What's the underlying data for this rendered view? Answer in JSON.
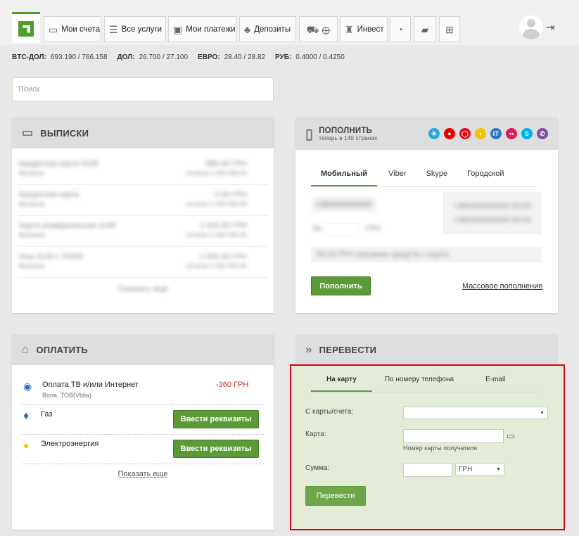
{
  "nav": {
    "items": [
      {
        "label": "Мои счета",
        "icon": "card-icon"
      },
      {
        "label": "Все услуги",
        "icon": "list-icon"
      },
      {
        "label": "Мои платежи",
        "icon": "monitor-icon"
      },
      {
        "label": "Депозиты",
        "icon": "piggy-icon"
      },
      {
        "label": "",
        "icon": "travel-icon"
      },
      {
        "label": "Инвест",
        "icon": "money-bag-icon"
      },
      {
        "label": "",
        "icon": "gauge-icon"
      },
      {
        "label": "",
        "icon": "chat-icon"
      },
      {
        "label": "",
        "icon": "cart-icon"
      }
    ]
  },
  "rates": [
    {
      "name": "BTC-ДОЛ:",
      "value": "693.190 / 766.158"
    },
    {
      "name": "ДОЛ:",
      "value": "26.700 / 27.100"
    },
    {
      "name": "ЕВРО:",
      "value": "28.40 / 28.82"
    },
    {
      "name": "РУБ:",
      "value": "0.4000 / 0.4250"
    }
  ],
  "search": {
    "placeholder": "Поиск"
  },
  "statements": {
    "title": "ВЫПИСКИ",
    "rows": [
      {
        "name": "Кредитная карта 5168",
        "sub": "Выписка",
        "amount": "-980.00 ГРН",
        "sub2": "остаток 1 000 000.00"
      },
      {
        "name": "Кредитная карта",
        "sub": "Выписка",
        "amount": "0.00 ГРН",
        "sub2": "остаток 1 000 000.00"
      },
      {
        "name": "Карта универсальная 4149",
        "sub": "Выписка",
        "amount": "1 000.00 ГРН",
        "sub2": "остаток 1 000 000.00"
      },
      {
        "name": "Visa 4149 с 24200",
        "sub": "Выписка",
        "amount": "1 000.00 ГРН",
        "sub2": "остаток 1 000 000.00"
      }
    ],
    "more": "Показать еще"
  },
  "topup": {
    "title": "ПОПОЛНИТЬ",
    "subtitle": "теперь в 140 странах",
    "tabs": [
      "Мобильный",
      "Viber",
      "Skype",
      "Городской"
    ],
    "phone": "+380000000000",
    "sum_label": "За",
    "currency": "ГРН",
    "info1": "+380000000000 00:00",
    "info2": "+380000000000 00:00",
    "card_line": "50.00 ГРН списание средств с карты",
    "button": "Пополнить",
    "mass": "Массовое пополнение",
    "operators": [
      {
        "name": "kyivstar-icon",
        "color": "#29a8e0"
      },
      {
        "name": "vodafone-icon",
        "color": "#e60000"
      },
      {
        "name": "mts-icon",
        "color": "#e30613"
      },
      {
        "name": "lifecell-icon",
        "color": "#f2c300"
      },
      {
        "name": "intertelecom-icon",
        "color": "#2a77c4"
      },
      {
        "name": "peoplenet-icon",
        "color": "#d81e5b"
      },
      {
        "name": "skype-icon",
        "color": "#00aff0"
      },
      {
        "name": "viber-icon",
        "color": "#7b519d"
      }
    ]
  },
  "pay": {
    "title": "ОПЛАТИТЬ",
    "items": [
      {
        "name": "Оплата ТВ и/или Интернет",
        "sub": "Воля, ТОВ(Vblia)",
        "amount": "-360 ГРН",
        "icon": "tv-icon"
      },
      {
        "name": "Газ",
        "sub": "",
        "button": "Ввести реквизиты",
        "icon": "flame-icon"
      },
      {
        "name": "Электроэнергия",
        "sub": "",
        "button": "Ввести реквизиты",
        "icon": "bulb-icon"
      }
    ],
    "more": "Показать еще"
  },
  "transfer": {
    "title": "ПЕРЕВЕСТИ",
    "tabs": [
      "На карту",
      "По номеру телефона",
      "E-mail"
    ],
    "from_label": "С карты/счета:",
    "card_label": "Карта:",
    "card_hint": "Номер карты получателя",
    "sum_label": "Сумма:",
    "currency": "ГРН",
    "button": "Перевести"
  },
  "colors": {
    "accent": "#5b9b37",
    "highlight": "#d9001a"
  }
}
